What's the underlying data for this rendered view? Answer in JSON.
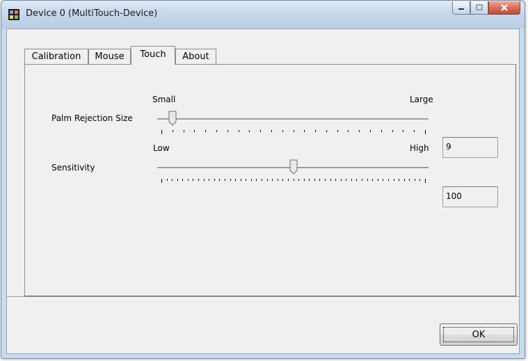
{
  "window": {
    "title": "Device 0 (MultiTouch-Device)"
  },
  "caption_buttons": {
    "minimize": "minimize-icon",
    "maximize": "maximize-icon",
    "close": "close-icon"
  },
  "tabs": [
    {
      "label": "Calibration",
      "active": false
    },
    {
      "label": "Mouse",
      "active": false
    },
    {
      "label": "Touch",
      "active": true
    },
    {
      "label": "About",
      "active": false
    }
  ],
  "palm_rejection": {
    "label": "Palm Rejection Size",
    "min_label": "Small",
    "max_label": "Large",
    "value": "9",
    "min": 8,
    "max": 32,
    "tick_count": 25
  },
  "sensitivity": {
    "label": "Sensitivity",
    "min_label": "Low",
    "max_label": "High",
    "value": "100",
    "min": 0,
    "max": 200,
    "tick_count": 51
  },
  "buttons": {
    "ok": "OK"
  },
  "colors": {
    "titlebar": "#c8d8ec",
    "close_button": "#c44a2f",
    "dialog_bg": "#f0f0f0"
  }
}
